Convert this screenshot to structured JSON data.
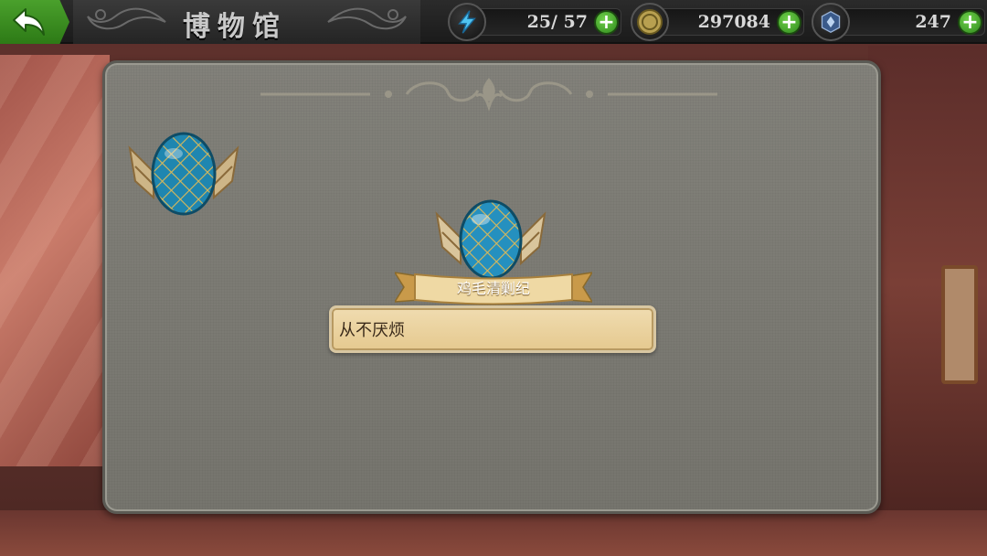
{
  "header": {
    "title": "博物馆",
    "back_icon": "back-arrow-icon"
  },
  "resources": {
    "energy": {
      "icon": "lightning-icon",
      "value": "25/ 57",
      "plus": "+"
    },
    "coin": {
      "icon": "coin-icon",
      "value": "297084",
      "plus": "+"
    },
    "gem": {
      "icon": "crystal-badge-icon",
      "value": "247",
      "plus": "+"
    }
  },
  "panel": {
    "badge_icon": "winged-egg-badge-icon",
    "selected": {
      "name": "鸡毛清剿纪",
      "description": "从不厌烦"
    }
  },
  "colors": {
    "back_button": "#3a8e22",
    "plus_button": "#4caf35",
    "egg": "#1f86b0",
    "panel": "#7c7b74",
    "desc_box": "#ecd6a6"
  }
}
